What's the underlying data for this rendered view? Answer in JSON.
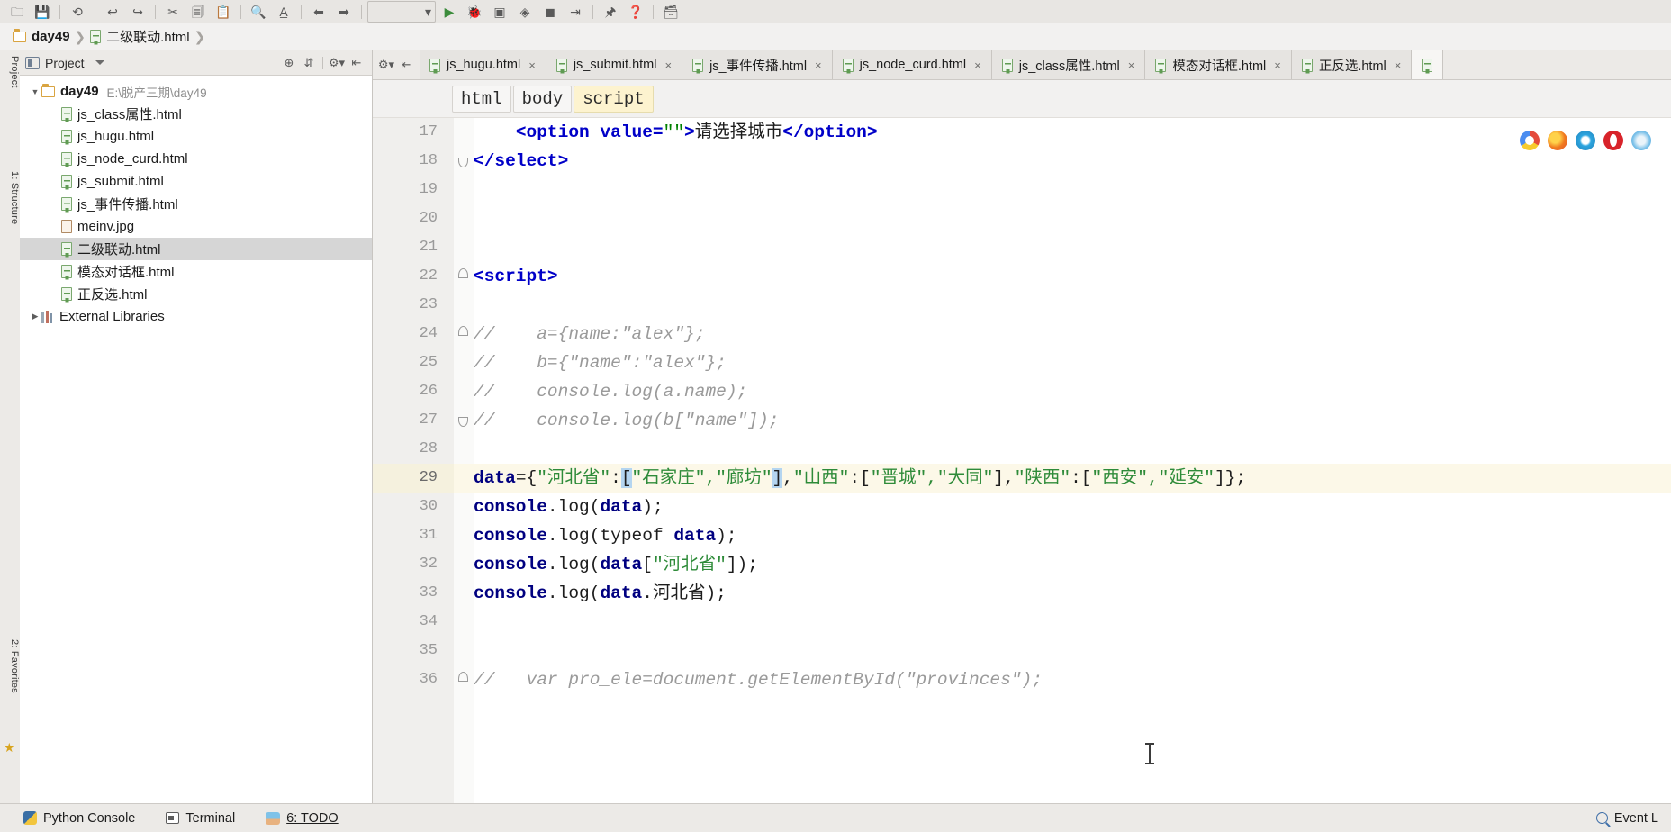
{
  "window": {
    "breadcrumb": [
      {
        "icon": "folder-icon",
        "label": "day49"
      },
      {
        "icon": "html-file-icon",
        "label": "二级联动.html"
      }
    ]
  },
  "toolbar": {
    "icons": [
      "open-folder-icon",
      "save-icon",
      "sync-icon",
      "undo-icon",
      "redo-icon",
      "cut-icon",
      "copy-icon",
      "paste-icon",
      "search-icon",
      "replace-icon",
      "back-icon",
      "forward-icon",
      "run-config-dropdown",
      "run-icon",
      "debug-icon",
      "coverage-icon",
      "profile-icon",
      "stop-icon",
      "step-icon",
      "attach-icon",
      "help-icon",
      "settings-icon"
    ]
  },
  "left_tool_tabs": [
    {
      "label": "Project",
      "name": "tool-tab-project"
    },
    {
      "label": "1: Structure",
      "name": "tool-tab-structure"
    },
    {
      "label": "2: Favorites",
      "name": "tool-tab-favorites"
    }
  ],
  "project_panel": {
    "title": "Project",
    "header_buttons": [
      "locate-icon",
      "collapse-all-icon",
      "gear-icon",
      "hide-icon"
    ],
    "tree": [
      {
        "indent": 0,
        "arrow": "▼",
        "icon": "folder-icon",
        "label": "day49",
        "bold": true,
        "path": "E:\\脱产三期\\day49",
        "selected": false
      },
      {
        "indent": 1,
        "arrow": "",
        "icon": "html-file-icon",
        "label": "js_class属性.html",
        "bold": false,
        "path": "",
        "selected": false
      },
      {
        "indent": 1,
        "arrow": "",
        "icon": "html-file-icon",
        "label": "js_hugu.html",
        "bold": false,
        "path": "",
        "selected": false
      },
      {
        "indent": 1,
        "arrow": "",
        "icon": "html-file-icon",
        "label": "js_node_curd.html",
        "bold": false,
        "path": "",
        "selected": false
      },
      {
        "indent": 1,
        "arrow": "",
        "icon": "html-file-icon",
        "label": "js_submit.html",
        "bold": false,
        "path": "",
        "selected": false
      },
      {
        "indent": 1,
        "arrow": "",
        "icon": "html-file-icon",
        "label": "js_事件传播.html",
        "bold": false,
        "path": "",
        "selected": false
      },
      {
        "indent": 1,
        "arrow": "",
        "icon": "jpg-file-icon",
        "label": "meinv.jpg",
        "bold": false,
        "path": "",
        "selected": false
      },
      {
        "indent": 1,
        "arrow": "",
        "icon": "html-file-icon",
        "label": "二级联动.html",
        "bold": false,
        "path": "",
        "selected": true
      },
      {
        "indent": 1,
        "arrow": "",
        "icon": "html-file-icon",
        "label": "模态对话框.html",
        "bold": false,
        "path": "",
        "selected": false
      },
      {
        "indent": 1,
        "arrow": "",
        "icon": "html-file-icon",
        "label": "正反选.html",
        "bold": false,
        "path": "",
        "selected": false
      },
      {
        "indent": 0,
        "arrow": "▶",
        "icon": "libraries-icon",
        "label": "External Libraries",
        "bold": false,
        "path": "",
        "selected": false
      }
    ]
  },
  "editor": {
    "tabs": [
      {
        "label": "js_hugu.html",
        "active": false
      },
      {
        "label": "js_submit.html",
        "active": false
      },
      {
        "label": "js_事件传播.html",
        "active": false
      },
      {
        "label": "js_node_curd.html",
        "active": false
      },
      {
        "label": "js_class属性.html",
        "active": false
      },
      {
        "label": "模态对话框.html",
        "active": false
      },
      {
        "label": "正反选.html",
        "active": false
      },
      {
        "label": "",
        "active": true
      }
    ],
    "tab_close_glyph": "×",
    "structure_crumbs": [
      {
        "label": "html",
        "highlighted": false
      },
      {
        "label": "body",
        "highlighted": false
      },
      {
        "label": "script",
        "highlighted": true
      }
    ],
    "browser_icons": [
      "chrome-icon",
      "firefox-icon",
      "ie-icon",
      "opera-icon",
      "safari-icon"
    ],
    "current_line": 29,
    "lines": [
      {
        "n": 17,
        "fold": "",
        "segs": [
          {
            "t": "    ",
            "c": "plain"
          },
          {
            "t": "<option value=",
            "c": "tag"
          },
          {
            "t": "\"\"",
            "c": "str"
          },
          {
            "t": ">",
            "c": "tag"
          },
          {
            "t": "请选择城市",
            "c": "plain"
          },
          {
            "t": "</option>",
            "c": "tag"
          }
        ]
      },
      {
        "n": 18,
        "fold": "end",
        "segs": [
          {
            "t": "</select>",
            "c": "tag"
          }
        ]
      },
      {
        "n": 19,
        "fold": "",
        "segs": []
      },
      {
        "n": 20,
        "fold": "",
        "segs": []
      },
      {
        "n": 21,
        "fold": "",
        "segs": []
      },
      {
        "n": 22,
        "fold": "start",
        "segs": [
          {
            "t": "<script>",
            "c": "tag"
          }
        ]
      },
      {
        "n": 23,
        "fold": "",
        "segs": []
      },
      {
        "n": 24,
        "fold": "start",
        "segs": [
          {
            "t": "//    a={name:\"alex\"};",
            "c": "cmt"
          }
        ]
      },
      {
        "n": 25,
        "fold": "",
        "segs": [
          {
            "t": "//    b={\"name\":\"alex\"};",
            "c": "cmt"
          }
        ]
      },
      {
        "n": 26,
        "fold": "",
        "segs": [
          {
            "t": "//    console.log(a.name);",
            "c": "cmt"
          }
        ]
      },
      {
        "n": 27,
        "fold": "end",
        "segs": [
          {
            "t": "//    console.log(b[\"name\"]);",
            "c": "cmt"
          }
        ]
      },
      {
        "n": 28,
        "fold": "",
        "segs": []
      },
      {
        "n": 29,
        "fold": "",
        "segs": [
          {
            "t": "data",
            "c": "kw"
          },
          {
            "t": "={",
            "c": "plain"
          },
          {
            "t": "\"河北省\"",
            "c": "grn"
          },
          {
            "t": ":",
            "c": "plain"
          },
          {
            "t": "[",
            "c": "sel"
          },
          {
            "t": "\"石家庄\",\"廊坊\"",
            "c": "grn"
          },
          {
            "t": "]",
            "c": "sel"
          },
          {
            "t": ",",
            "c": "plain"
          },
          {
            "t": "\"山西\"",
            "c": "grn"
          },
          {
            "t": ":[",
            "c": "plain"
          },
          {
            "t": "\"晋城\",\"大同\"",
            "c": "grn"
          },
          {
            "t": "],",
            "c": "plain"
          },
          {
            "t": "\"陕西\"",
            "c": "grn"
          },
          {
            "t": ":[",
            "c": "plain"
          },
          {
            "t": "\"西安\",\"延安\"",
            "c": "grn"
          },
          {
            "t": "]};",
            "c": "plain"
          }
        ]
      },
      {
        "n": 30,
        "fold": "",
        "segs": [
          {
            "t": "console",
            "c": "kw"
          },
          {
            "t": ".log(",
            "c": "plain"
          },
          {
            "t": "data",
            "c": "kw"
          },
          {
            "t": ");",
            "c": "plain"
          }
        ]
      },
      {
        "n": 31,
        "fold": "",
        "segs": [
          {
            "t": "console",
            "c": "kw"
          },
          {
            "t": ".log(",
            "c": "plain"
          },
          {
            "t": "typeof",
            "c": "plain"
          },
          {
            "t": " ",
            "c": "plain"
          },
          {
            "t": "data",
            "c": "kw"
          },
          {
            "t": ");",
            "c": "plain"
          }
        ]
      },
      {
        "n": 32,
        "fold": "",
        "segs": [
          {
            "t": "console",
            "c": "kw"
          },
          {
            "t": ".log(",
            "c": "plain"
          },
          {
            "t": "data",
            "c": "kw"
          },
          {
            "t": "[",
            "c": "plain"
          },
          {
            "t": "\"河北省\"",
            "c": "grn"
          },
          {
            "t": "]);",
            "c": "plain"
          }
        ]
      },
      {
        "n": 33,
        "fold": "",
        "segs": [
          {
            "t": "console",
            "c": "kw"
          },
          {
            "t": ".log(",
            "c": "plain"
          },
          {
            "t": "data",
            "c": "kw"
          },
          {
            "t": ".河北省);",
            "c": "plain"
          }
        ]
      },
      {
        "n": 34,
        "fold": "",
        "segs": []
      },
      {
        "n": 35,
        "fold": "",
        "segs": []
      },
      {
        "n": 36,
        "fold": "start",
        "segs": [
          {
            "t": "//   var pro_ele=document.getElementById(\"provinces\");",
            "c": "cmt"
          }
        ]
      }
    ]
  },
  "status_bar": {
    "items": [
      {
        "icon": "python-icon",
        "label": "Python Console"
      },
      {
        "icon": "terminal-icon",
        "label": "Terminal"
      },
      {
        "icon": "todo-icon",
        "label": "6: TODO",
        "mnemonic": "6"
      }
    ],
    "right": {
      "icon": "search-icon",
      "label": "Event L"
    }
  },
  "colors": {
    "selection_blue": "#b4d5f0",
    "current_line": "#fcf8e8",
    "string_green": "#2e8b39",
    "tag_blue": "#0000c8",
    "comment_gray": "#9a9a9a",
    "tree_selection": "#d6d6d6"
  }
}
